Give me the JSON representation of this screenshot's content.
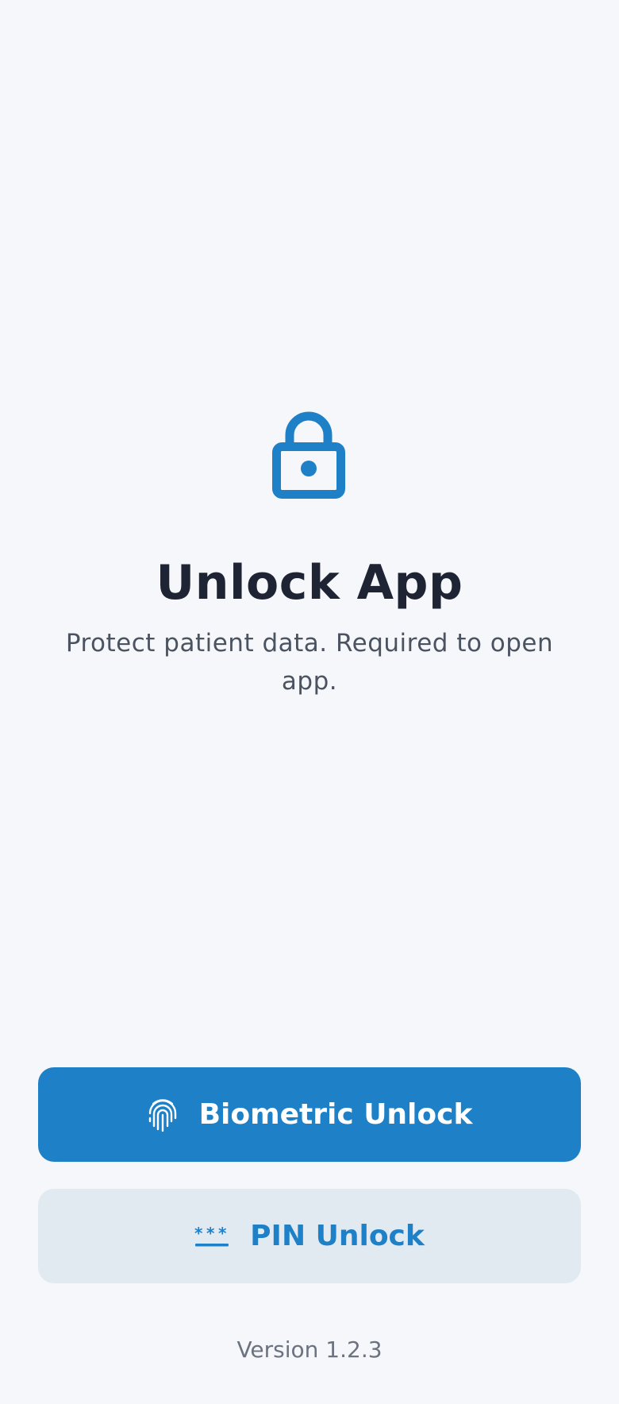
{
  "lock_screen": {
    "icon": "lock-icon",
    "title": "Unlock App",
    "subtitle": "Protect patient data. Required to open app."
  },
  "actions": {
    "biometric": {
      "label": "Biometric Unlock",
      "icon": "fingerprint-icon"
    },
    "pin": {
      "label": "PIN Unlock",
      "icon": "pin-dots-icon"
    }
  },
  "footer": {
    "version": "Version 1.2.3"
  },
  "colors": {
    "background": "#f5f7fa",
    "accent": "#1e81c8",
    "secondary_button_bg": "#e1e9f1",
    "title_text": "#1e2433",
    "body_text": "#4b5361",
    "muted_text": "#6b7280"
  }
}
